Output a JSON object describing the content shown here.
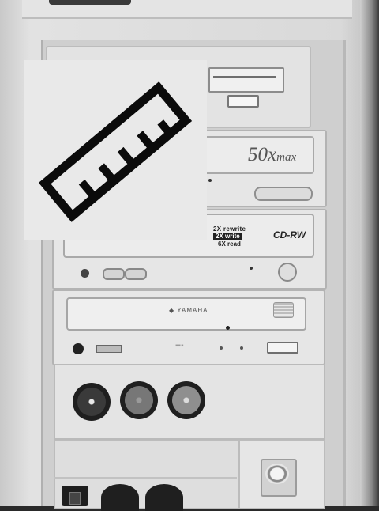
{
  "drive_1": {
    "speed_text": "50x",
    "speed_suffix": "max"
  },
  "drive_2": {
    "rewrite_label": "2X rewrite",
    "write_label": "2X write",
    "read_label": "6X read",
    "format_label": "CD-RW"
  },
  "drive_3": {
    "brand": "YAMAHA"
  },
  "overlay": {
    "icon": "ruler-icon"
  }
}
